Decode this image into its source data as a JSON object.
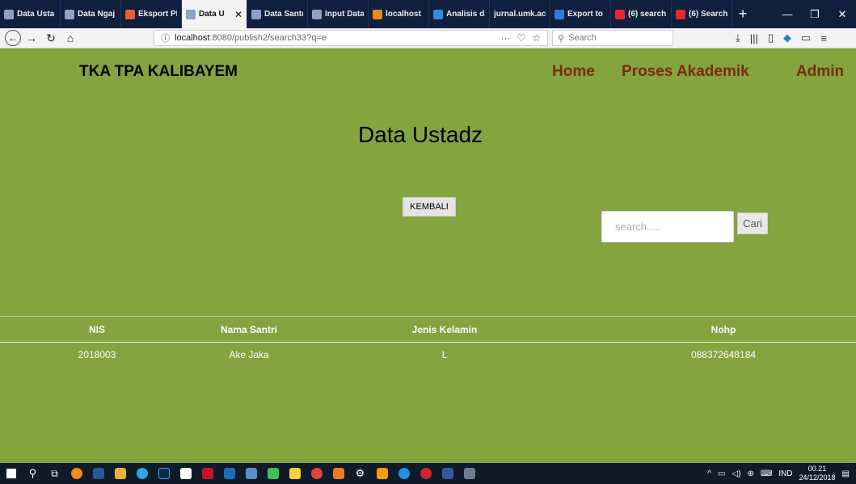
{
  "browser": {
    "tabs": [
      {
        "label": "Data Usta",
        "color": "#8fa1c4"
      },
      {
        "label": "Data Ngaj",
        "color": "#8fa1c4"
      },
      {
        "label": "Eksport PE",
        "color": "#e0642a"
      },
      {
        "label": "Data U",
        "color": "#8fa1c4",
        "active": true
      },
      {
        "label": "Data Santr",
        "color": "#8fa1c4"
      },
      {
        "label": "Input Data",
        "color": "#8fa1c4"
      },
      {
        "label": "localhost",
        "color": "#e88a1a"
      },
      {
        "label": "Analisis da",
        "color": "#2f8ad8"
      },
      {
        "label": "jurnal.umk.ac",
        "color": "#0f1f3d"
      },
      {
        "label": "Export to",
        "color": "#2f7bd8"
      },
      {
        "label": "(6) search",
        "color": "#e32b2b"
      },
      {
        "label": "(6) Search",
        "color": "#e32b2b"
      }
    ],
    "new_tab": "+",
    "url_info": "ⓘ",
    "url_host": "localhost",
    "url_path": ":8080/publish2/search33?q=e",
    "url_more": "···",
    "search_placeholder": "Search"
  },
  "page": {
    "brand": "TKA TPA KALIBAYEM",
    "nav": {
      "home": "Home",
      "akademik": "Proses Akademik",
      "admin": "Admin"
    },
    "title": "Data Ustadz",
    "back_button": "KEMBALI",
    "search": {
      "placeholder": "search.....",
      "button": "Cari"
    },
    "table": {
      "headers": [
        "NIS",
        "Nama Santri",
        "Jenis Kelamin",
        "Nohp"
      ],
      "rows": [
        [
          "2018003",
          "Ake Jaka",
          "L",
          "088372648184"
        ]
      ]
    }
  },
  "taskbar": {
    "lang": "IND",
    "time": "00.21",
    "date": "24/12/2018"
  }
}
